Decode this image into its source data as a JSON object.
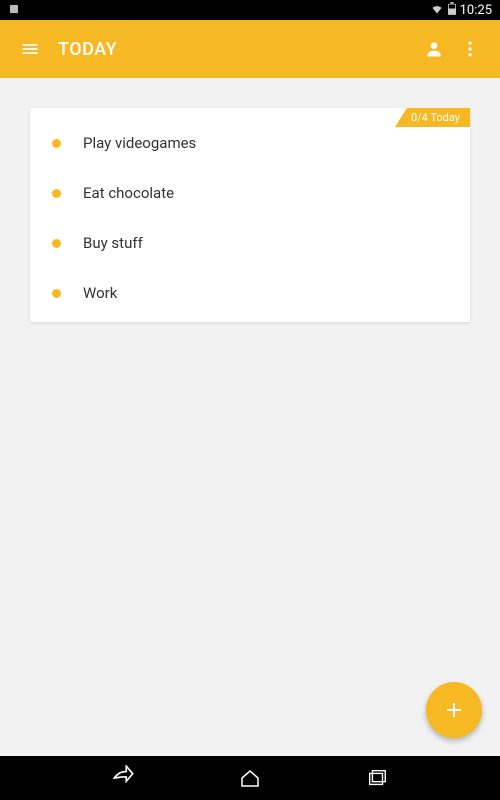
{
  "status": {
    "time": "10:25"
  },
  "appbar": {
    "title": "TODAY"
  },
  "badge": {
    "text": "0/4 Today"
  },
  "tasks": [
    {
      "label": "Play videogames"
    },
    {
      "label": "Eat chocolate"
    },
    {
      "label": "Buy stuff"
    },
    {
      "label": "Work"
    }
  ],
  "colors": {
    "accent": "#f6b924"
  }
}
